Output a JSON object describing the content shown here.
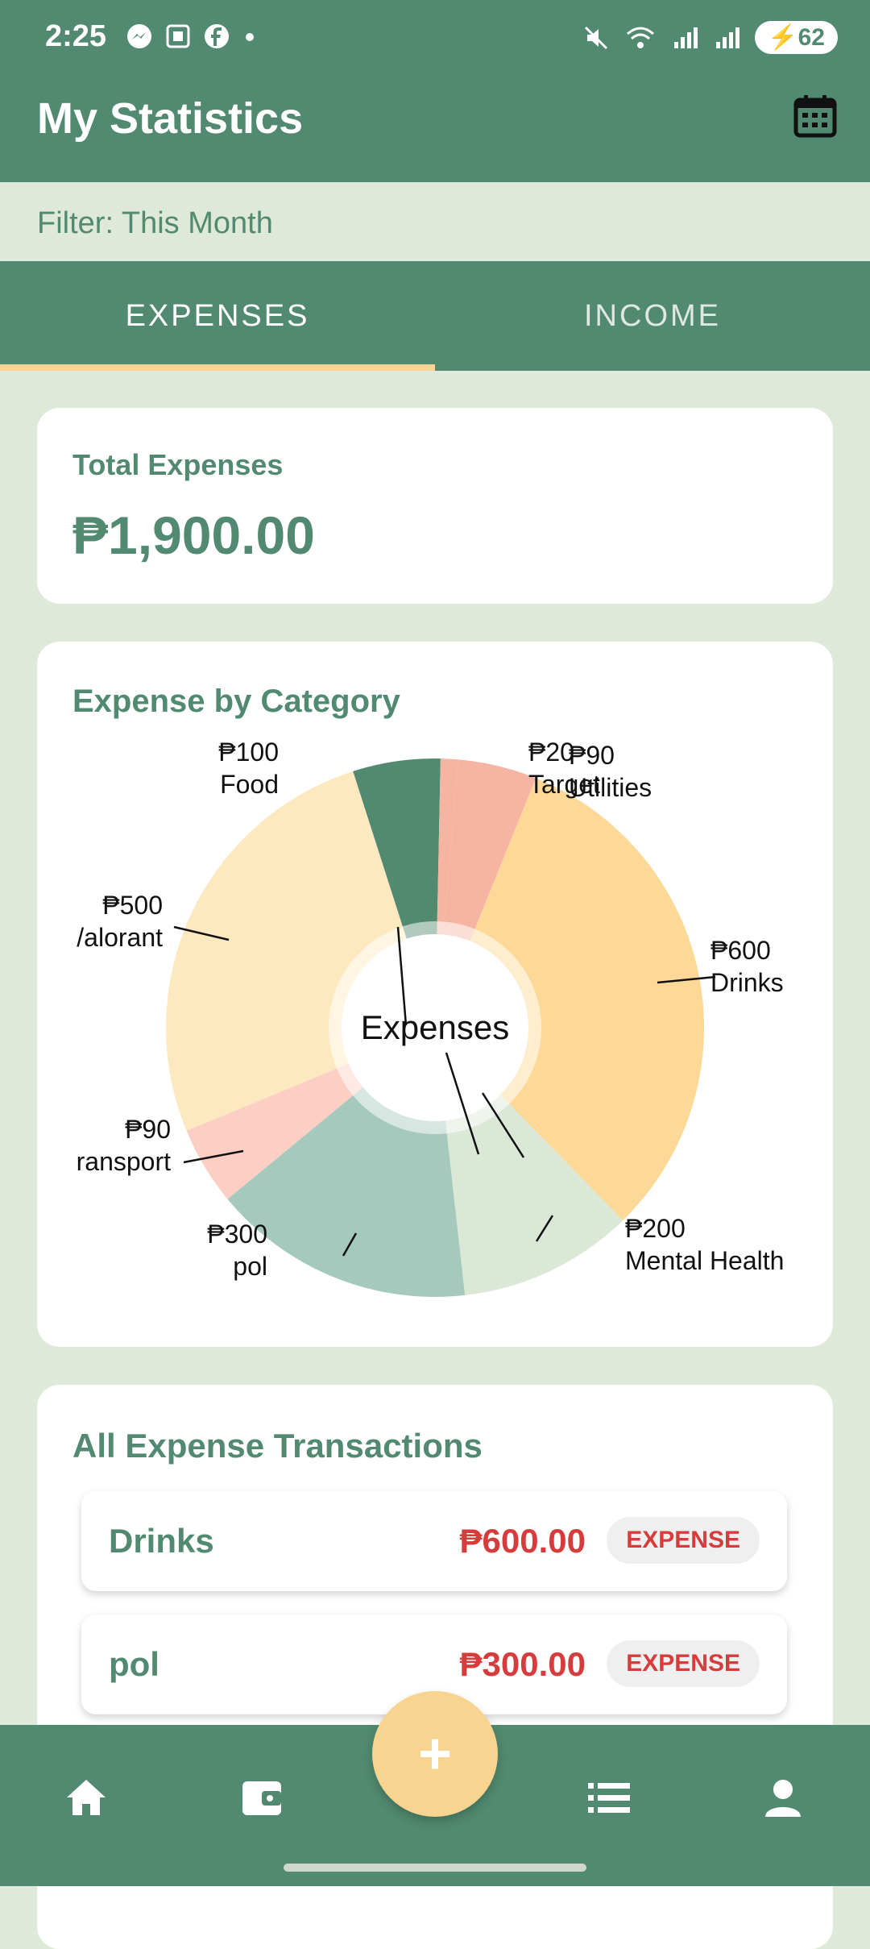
{
  "status_bar": {
    "time": "2:25",
    "battery": "62",
    "icons_left": [
      "messenger-icon",
      "scan-icon",
      "facebook-icon",
      "dot-icon"
    ],
    "icons_right": [
      "mute-icon",
      "wifi-icon",
      "signal-icon",
      "signal-icon"
    ]
  },
  "app_bar": {
    "title": "My Statistics",
    "calendar_icon": "calendar-icon"
  },
  "filter": {
    "label": "Filter: This Month"
  },
  "tabs": [
    {
      "label": "EXPENSES",
      "active": true
    },
    {
      "label": "INCOME",
      "active": false
    }
  ],
  "summary": {
    "title": "Total Expenses",
    "amount": "₱1,900.00"
  },
  "chart": {
    "title": "Expense by Category",
    "center_label": "Expenses"
  },
  "chart_data": {
    "type": "pie",
    "title": "Expense by Category",
    "center_label": "Expenses",
    "slices": [
      {
        "label": "Food",
        "value": 100,
        "value_label": "₱100",
        "color": "#518a70"
      },
      {
        "label": "Target",
        "value": 20,
        "value_label": "₱20",
        "color": "#f6b5a3"
      },
      {
        "label": "Utilities",
        "value": 90,
        "value_label": "₱90",
        "color": "#f6b5a3"
      },
      {
        "label": "Drinks",
        "value": 600,
        "value_label": "₱600",
        "color": "#fdd896"
      },
      {
        "label": "Mental Health",
        "value": 200,
        "value_label": "₱200",
        "color": "#dbe8d6"
      },
      {
        "label": "pol",
        "value": 300,
        "value_label": "₱300",
        "color": "#a5c9bd"
      },
      {
        "label": "Transport",
        "value": 90,
        "value_label": "₱90",
        "color": "#fdcfc4"
      },
      {
        "label": "Valorant",
        "value": 500,
        "value_label": "₱500",
        "color": "#fde9c0"
      }
    ],
    "visible_labels": {
      "Transport": "ransport",
      "Valorant": "/alorant",
      "Utilities": "Utilities"
    }
  },
  "transactions": {
    "title": "All Expense Transactions",
    "items": [
      {
        "name": "Drinks",
        "amount": "₱600.00",
        "type": "EXPENSE"
      },
      {
        "name": "pol",
        "amount": "₱300.00",
        "type": "EXPENSE"
      }
    ]
  },
  "bottom_nav": {
    "items": [
      "home-icon",
      "wallet-icon",
      "add-icon",
      "list-icon",
      "profile-icon"
    ],
    "fab_label": "+"
  }
}
